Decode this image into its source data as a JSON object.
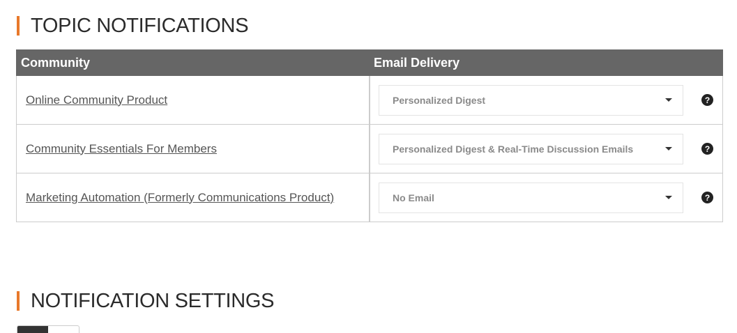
{
  "topic_notifications": {
    "heading": "TOPIC NOTIFICATIONS",
    "columns": {
      "community": "Community",
      "email_delivery": "Email Delivery"
    },
    "rows": [
      {
        "community": "Online Community Product",
        "email_delivery": "Personalized Digest"
      },
      {
        "community": "Community Essentials For Members",
        "email_delivery": "Personalized Digest & Real-Time Discussion Emails"
      },
      {
        "community": "Marketing Automation (Formerly Communications Product)",
        "email_delivery": "No Email"
      }
    ],
    "help_icon_glyph": "?"
  },
  "notification_settings": {
    "heading": "NOTIFICATION SETTINGS"
  },
  "colors": {
    "accent": "#e8792b",
    "header_bg": "#666666"
  },
  "icons": [
    "caret-down-icon",
    "help-icon"
  ]
}
